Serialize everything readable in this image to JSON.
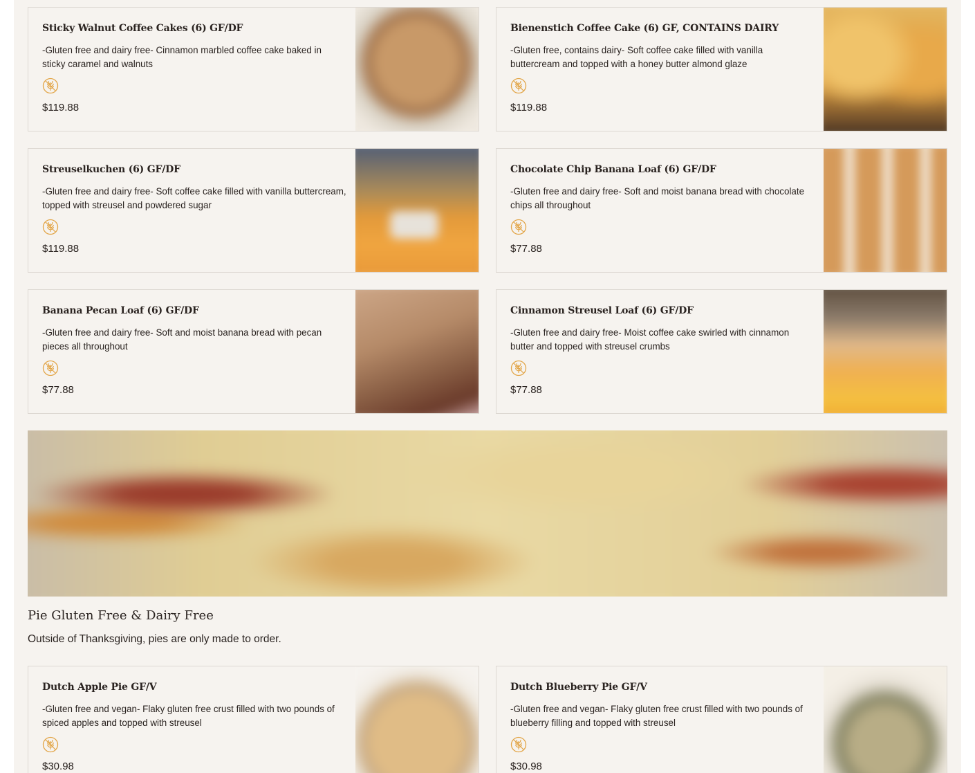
{
  "menu_items": [
    {
      "title": "Sticky Walnut Coffee Cakes (6) GF/DF",
      "description": "-Gluten free and dairy free- Cinnamon marbled coffee cake baked in sticky caramel and walnuts",
      "badge_icon": "gluten-free-icon",
      "price": "$119.88"
    },
    {
      "title": "Bienenstich Coffee Cake (6) GF, CONTAINS DAIRY",
      "description": "-Gluten free, contains dairy- Soft coffee cake filled with vanilla buttercream and topped with a honey butter almond glaze",
      "badge_icon": "gluten-free-icon",
      "price": "$119.88"
    },
    {
      "title": "Streuselkuchen (6) GF/DF",
      "description": "-Gluten free and dairy free- Soft coffee cake filled with vanilla buttercream, topped with streusel and powdered sugar",
      "badge_icon": "gluten-free-icon",
      "price": "$119.88"
    },
    {
      "title": "Chocolate Chip Banana Loaf (6) GF/DF",
      "description": "-Gluten free and dairy free- Soft and moist banana bread with chocolate chips all throughout",
      "badge_icon": "gluten-free-icon",
      "price": "$77.88"
    },
    {
      "title": "Banana Pecan Loaf (6) GF/DF",
      "description": "-Gluten free and dairy free- Soft and moist banana bread with pecan pieces all throughout",
      "badge_icon": "gluten-free-icon",
      "price": "$77.88"
    },
    {
      "title": "Cinnamon Streusel Loaf (6) GF/DF",
      "description": "-Gluten free and dairy free- Moist coffee cake swirled with cinnamon butter and topped with streusel crumbs",
      "badge_icon": "gluten-free-icon",
      "price": "$77.88"
    }
  ],
  "pie_section": {
    "title": "Pie Gluten Free & Dairy Free",
    "subtitle": "Outside of Thanksgiving, pies are only made to order.",
    "items": [
      {
        "title": "Dutch Apple Pie GF/V",
        "description": "-Gluten free and vegan- Flaky gluten free crust filled with two pounds of spiced apples and topped with streusel",
        "badge_icon": "gluten-free-icon",
        "price": "$30.98"
      },
      {
        "title": "Dutch Blueberry Pie GF/V",
        "description": "-Gluten free and vegan- Flaky gluten free crust filled with two pounds of blueberry filling and topped with streusel",
        "badge_icon": "gluten-free-icon",
        "price": "$30.98"
      }
    ]
  },
  "colors": {
    "background": "#f6f3ef",
    "card_border": "#ddd8d2",
    "text": "#2a2320",
    "badge": "#e2a445"
  }
}
